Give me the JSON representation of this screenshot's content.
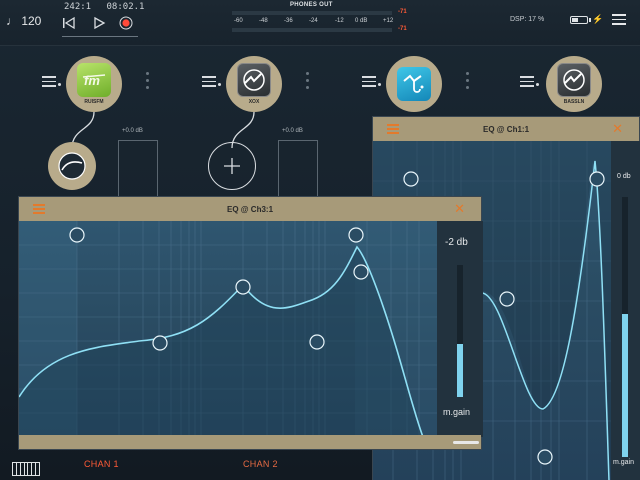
{
  "transport": {
    "tempo": "♩ 120",
    "bar_position": "242:1",
    "time_position": "08:02.1"
  },
  "meter": {
    "title": "PHONES OUT",
    "scale": [
      "-60",
      "-48",
      "-36",
      "-24",
      "-12",
      "0 dB",
      "+12"
    ],
    "peak_top": "-71",
    "peak_bottom": "-71"
  },
  "status": {
    "dsp": "DSP: 17 %"
  },
  "channels": [
    {
      "label": "CHAN 1",
      "plugin": "RUISFM",
      "fader": "+0.0 dB"
    },
    {
      "label": "CHAN 2",
      "plugin": "XOX",
      "fader": "+0.0 dB"
    },
    {
      "label": "",
      "plugin": "",
      "fader": ""
    },
    {
      "label": "",
      "plugin": "BASSLN",
      "fader": ""
    }
  ],
  "eq_front": {
    "title": "EQ @ Ch3:1",
    "gain_value": "-2 db",
    "gain_label": "m.gain",
    "gain_level": 0.4
  },
  "eq_back": {
    "title": "EQ @ Ch1:1",
    "gain_value": "0 db",
    "gain_label": "m.gain",
    "gain_level": 0.55
  },
  "colors": {
    "accent": "#e37a2c",
    "record": "#ff4a3a",
    "plugin_ring": "#b8ab8b",
    "panel_header": "#a79a79",
    "curve": "#8fe0f5"
  }
}
